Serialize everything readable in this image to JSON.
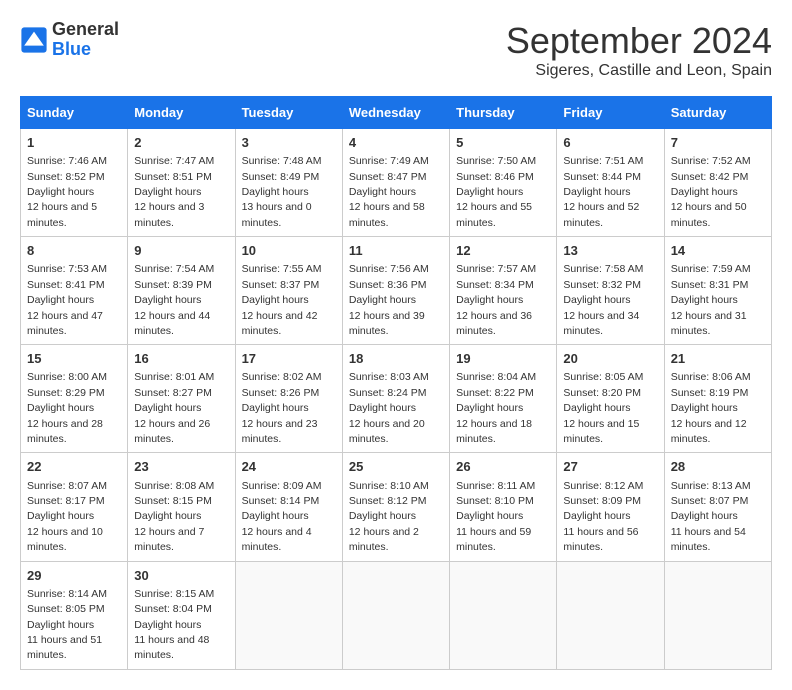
{
  "header": {
    "logo_general": "General",
    "logo_blue": "Blue",
    "month_title": "September 2024",
    "subtitle": "Sigeres, Castille and Leon, Spain"
  },
  "weekdays": [
    "Sunday",
    "Monday",
    "Tuesday",
    "Wednesday",
    "Thursday",
    "Friday",
    "Saturday"
  ],
  "weeks": [
    [
      {
        "day": "1",
        "sunrise": "7:46 AM",
        "sunset": "8:52 PM",
        "daylight": "12 hours and 5 minutes."
      },
      {
        "day": "2",
        "sunrise": "7:47 AM",
        "sunset": "8:51 PM",
        "daylight": "12 hours and 3 minutes."
      },
      {
        "day": "3",
        "sunrise": "7:48 AM",
        "sunset": "8:49 PM",
        "daylight": "13 hours and 0 minutes."
      },
      {
        "day": "4",
        "sunrise": "7:49 AM",
        "sunset": "8:47 PM",
        "daylight": "12 hours and 58 minutes."
      },
      {
        "day": "5",
        "sunrise": "7:50 AM",
        "sunset": "8:46 PM",
        "daylight": "12 hours and 55 minutes."
      },
      {
        "day": "6",
        "sunrise": "7:51 AM",
        "sunset": "8:44 PM",
        "daylight": "12 hours and 52 minutes."
      },
      {
        "day": "7",
        "sunrise": "7:52 AM",
        "sunset": "8:42 PM",
        "daylight": "12 hours and 50 minutes."
      }
    ],
    [
      {
        "day": "8",
        "sunrise": "7:53 AM",
        "sunset": "8:41 PM",
        "daylight": "12 hours and 47 minutes."
      },
      {
        "day": "9",
        "sunrise": "7:54 AM",
        "sunset": "8:39 PM",
        "daylight": "12 hours and 44 minutes."
      },
      {
        "day": "10",
        "sunrise": "7:55 AM",
        "sunset": "8:37 PM",
        "daylight": "12 hours and 42 minutes."
      },
      {
        "day": "11",
        "sunrise": "7:56 AM",
        "sunset": "8:36 PM",
        "daylight": "12 hours and 39 minutes."
      },
      {
        "day": "12",
        "sunrise": "7:57 AM",
        "sunset": "8:34 PM",
        "daylight": "12 hours and 36 minutes."
      },
      {
        "day": "13",
        "sunrise": "7:58 AM",
        "sunset": "8:32 PM",
        "daylight": "12 hours and 34 minutes."
      },
      {
        "day": "14",
        "sunrise": "7:59 AM",
        "sunset": "8:31 PM",
        "daylight": "12 hours and 31 minutes."
      }
    ],
    [
      {
        "day": "15",
        "sunrise": "8:00 AM",
        "sunset": "8:29 PM",
        "daylight": "12 hours and 28 minutes."
      },
      {
        "day": "16",
        "sunrise": "8:01 AM",
        "sunset": "8:27 PM",
        "daylight": "12 hours and 26 minutes."
      },
      {
        "day": "17",
        "sunrise": "8:02 AM",
        "sunset": "8:26 PM",
        "daylight": "12 hours and 23 minutes."
      },
      {
        "day": "18",
        "sunrise": "8:03 AM",
        "sunset": "8:24 PM",
        "daylight": "12 hours and 20 minutes."
      },
      {
        "day": "19",
        "sunrise": "8:04 AM",
        "sunset": "8:22 PM",
        "daylight": "12 hours and 18 minutes."
      },
      {
        "day": "20",
        "sunrise": "8:05 AM",
        "sunset": "8:20 PM",
        "daylight": "12 hours and 15 minutes."
      },
      {
        "day": "21",
        "sunrise": "8:06 AM",
        "sunset": "8:19 PM",
        "daylight": "12 hours and 12 minutes."
      }
    ],
    [
      {
        "day": "22",
        "sunrise": "8:07 AM",
        "sunset": "8:17 PM",
        "daylight": "12 hours and 10 minutes."
      },
      {
        "day": "23",
        "sunrise": "8:08 AM",
        "sunset": "8:15 PM",
        "daylight": "12 hours and 7 minutes."
      },
      {
        "day": "24",
        "sunrise": "8:09 AM",
        "sunset": "8:14 PM",
        "daylight": "12 hours and 4 minutes."
      },
      {
        "day": "25",
        "sunrise": "8:10 AM",
        "sunset": "8:12 PM",
        "daylight": "12 hours and 2 minutes."
      },
      {
        "day": "26",
        "sunrise": "8:11 AM",
        "sunset": "8:10 PM",
        "daylight": "11 hours and 59 minutes."
      },
      {
        "day": "27",
        "sunrise": "8:12 AM",
        "sunset": "8:09 PM",
        "daylight": "11 hours and 56 minutes."
      },
      {
        "day": "28",
        "sunrise": "8:13 AM",
        "sunset": "8:07 PM",
        "daylight": "11 hours and 54 minutes."
      }
    ],
    [
      {
        "day": "29",
        "sunrise": "8:14 AM",
        "sunset": "8:05 PM",
        "daylight": "11 hours and 51 minutes."
      },
      {
        "day": "30",
        "sunrise": "8:15 AM",
        "sunset": "8:04 PM",
        "daylight": "11 hours and 48 minutes."
      },
      null,
      null,
      null,
      null,
      null
    ]
  ]
}
